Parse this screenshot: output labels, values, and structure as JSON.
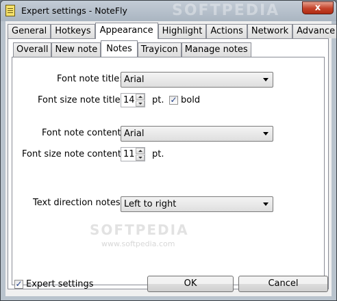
{
  "window": {
    "title": "Expert settings - NoteFly",
    "close_glyph": "x",
    "watermark": "SOFTPEDIA"
  },
  "main_tabs": [
    {
      "label": "General"
    },
    {
      "label": "Hotkeys"
    },
    {
      "label": "Appearance",
      "active": true
    },
    {
      "label": "Highlight"
    },
    {
      "label": "Actions"
    },
    {
      "label": "Network"
    },
    {
      "label": "Advance"
    }
  ],
  "sub_tabs": [
    {
      "label": "Overall"
    },
    {
      "label": "New note"
    },
    {
      "label": "Notes",
      "active": true
    },
    {
      "label": "Trayicon"
    },
    {
      "label": "Manage notes"
    }
  ],
  "notes": {
    "font_title_label": "Font note title:",
    "font_title_value": "Arial",
    "font_size_title_label": "Font size note title:",
    "font_size_title_value": "14",
    "pt_label_1": "pt.",
    "bold_label": "bold",
    "bold_checked": true,
    "font_content_label": "Font note content:",
    "font_content_value": "Arial",
    "font_size_content_label": "Font size note content:",
    "font_size_content_value": "11",
    "pt_label_2": "pt.",
    "text_direction_label": "Text direction notes:",
    "text_direction_value": "Left to right"
  },
  "inner_watermark": "SOFTPEDIA",
  "inner_watermark_url": "www.softpedia.com",
  "footer": {
    "expert_settings_label": "Expert settings",
    "expert_settings_checked": true,
    "ok_label": "OK",
    "cancel_label": "Cancel"
  },
  "icons": {
    "app": "notefly-app-icon",
    "check": "checkmark-icon",
    "dropdown": "chevron-down-icon",
    "spin_up": "spin-up-icon",
    "spin_down": "spin-down-icon"
  }
}
